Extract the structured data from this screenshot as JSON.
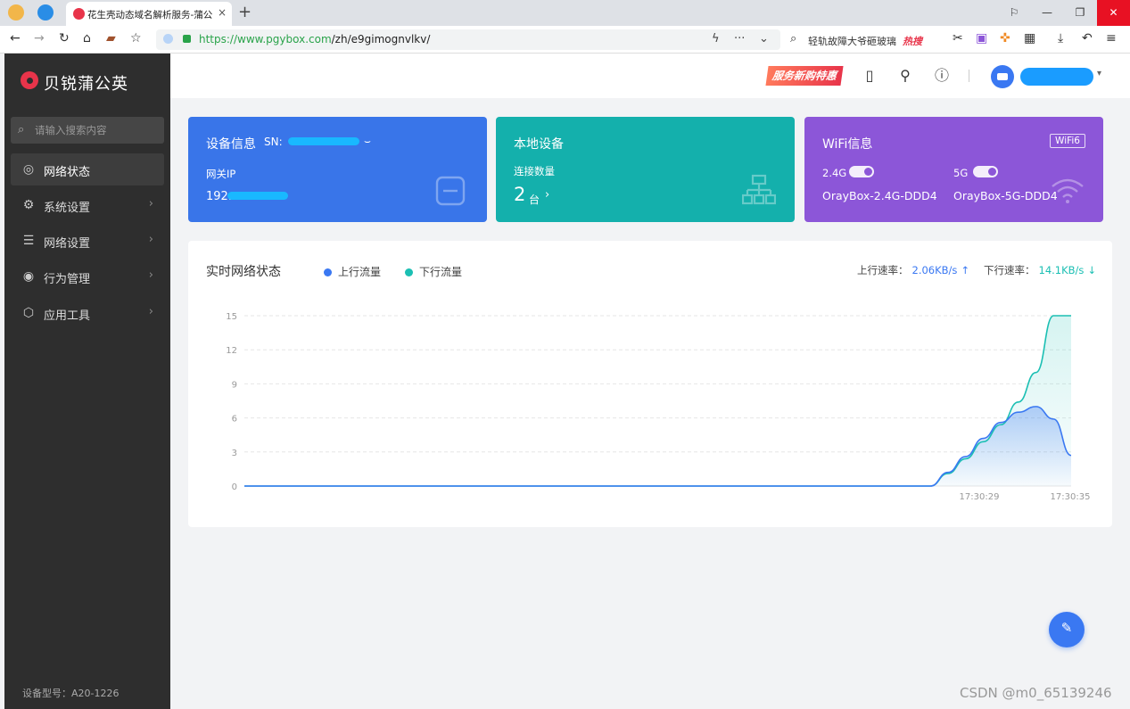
{
  "browser": {
    "tab_title": "花生壳动态域名解析服务-蒲公",
    "tab_close": "×",
    "new_tab": "+",
    "url_host": "https://www.pgybox.com",
    "url_path": "/zh/e9gimognvlkv/",
    "search_query": "轻轨故障大爷砸玻璃",
    "search_hot": "热搜",
    "window_controls": [
      "minimize",
      "restore",
      "close"
    ]
  },
  "sidebar": {
    "brand": "贝锐蒲公英",
    "search_placeholder": "请输入搜索内容",
    "items": [
      {
        "label": "网络状态",
        "icon": "globe-icon",
        "active": true
      },
      {
        "label": "系统设置",
        "icon": "gear-icon"
      },
      {
        "label": "网络设置",
        "icon": "sliders-icon"
      },
      {
        "label": "行为管理",
        "icon": "behavior-icon"
      },
      {
        "label": "应用工具",
        "icon": "box-icon"
      }
    ],
    "model_label": "设备型号：",
    "model_value": "A20-1226"
  },
  "header": {
    "promo": "服务新购特惠"
  },
  "cards": {
    "device": {
      "title": "设备信息",
      "sn_label": "SN:",
      "gateway_label": "网关IP",
      "gateway_value": "192."
    },
    "local": {
      "title": "本地设备",
      "count_label": "连接数量",
      "count_value": "2",
      "count_unit": "台"
    },
    "wifi": {
      "title": "WiFi信息",
      "badge": "WiFi6",
      "band1_label": "2.4G",
      "band1_ssid": "OrayBox-2.4G-DDD4",
      "band2_label": "5G",
      "band2_ssid": "OrayBox-5G-DDD4"
    }
  },
  "realtime": {
    "title": "实时网络状态",
    "legend_up": "上行流量",
    "legend_down": "下行流量",
    "up_rate_label": "上行速率：",
    "up_rate_value": "2.06KB/s",
    "down_rate_label": "下行速率：",
    "down_rate_value": "14.1KB/s"
  },
  "colors": {
    "upload": "#3a78f2",
    "download": "#1bbfb3",
    "card_device": "#3975e9",
    "card_local": "#14b0ac",
    "card_wifi": "#8c56d8"
  },
  "chart_data": {
    "type": "area",
    "ylim": [
      0,
      15
    ],
    "yticks": [
      "0",
      "3",
      "6",
      "9",
      "12",
      "15"
    ],
    "x": [
      "17:30:29",
      "17:30:35"
    ],
    "series": [
      {
        "name": "上行流量",
        "values": [
          0,
          0,
          0,
          0,
          0,
          0,
          0,
          0,
          0,
          0,
          0,
          0,
          0,
          0,
          0,
          0,
          0,
          0,
          0,
          0,
          0,
          0,
          0,
          0,
          0,
          0,
          0,
          0,
          0,
          0,
          0,
          0,
          0,
          0,
          0,
          0,
          0,
          0,
          0,
          0,
          1.2,
          2.6,
          4.2,
          5.6,
          6.5,
          7.0,
          5.9,
          2.7
        ]
      },
      {
        "name": "下行流量",
        "values": [
          0,
          0,
          0,
          0,
          0,
          0,
          0,
          0,
          0,
          0,
          0,
          0,
          0,
          0,
          0,
          0,
          0,
          0,
          0,
          0,
          0,
          0,
          0,
          0,
          0,
          0,
          0,
          0,
          0,
          0,
          0,
          0,
          0,
          0,
          0,
          0,
          0,
          0,
          0,
          0,
          1.1,
          2.4,
          3.9,
          5.4,
          7.4,
          10.0,
          15.0,
          15.0
        ]
      }
    ]
  },
  "watermark": "CSDN @m0_65139246"
}
